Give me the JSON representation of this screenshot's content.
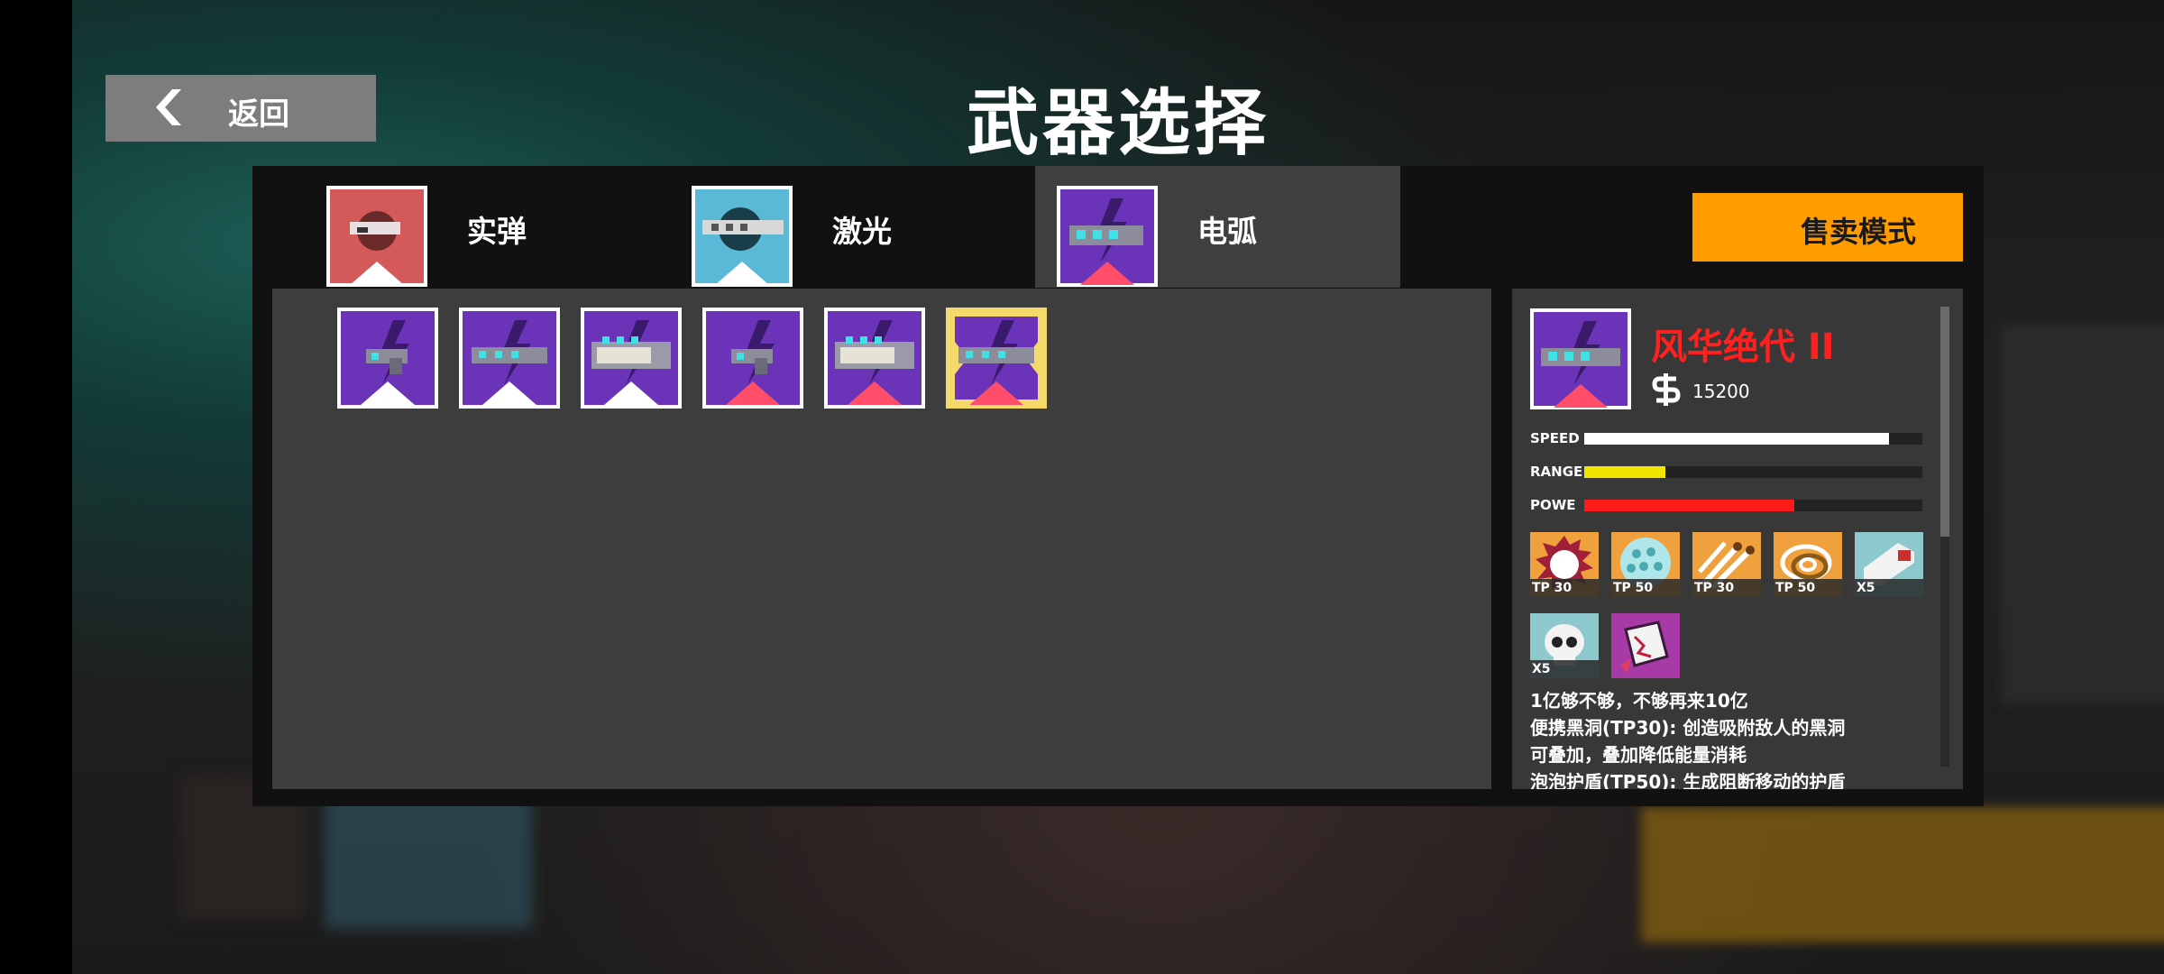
{
  "header": {
    "back_label": "返回",
    "title": "武器选择"
  },
  "tabs": [
    {
      "label": "实弹",
      "active": false
    },
    {
      "label": "激光",
      "active": false
    },
    {
      "label": "电弧",
      "active": true
    }
  ],
  "sell_button": {
    "label": "售卖模式"
  },
  "weapons": [
    {
      "icon": "arc-pistol-icon",
      "tier": "white",
      "selected": false
    },
    {
      "icon": "arc-rifle-icon",
      "tier": "white",
      "selected": false
    },
    {
      "icon": "arc-heavy-gun-icon",
      "tier": "white",
      "selected": false
    },
    {
      "icon": "arc-pistol-icon",
      "tier": "red",
      "selected": false
    },
    {
      "icon": "arc-heavy-gun-icon",
      "tier": "red",
      "selected": false
    },
    {
      "icon": "arc-rifle-icon",
      "tier": "red",
      "selected": true
    }
  ],
  "detail": {
    "name": "风华绝代 II",
    "price": "15200",
    "stats": [
      {
        "label": "SPEED",
        "value": 0.9,
        "color": "#ffffff"
      },
      {
        "label": "RANGE",
        "value": 0.24,
        "color": "#f2e600"
      },
      {
        "label": "POWE",
        "value": 0.62,
        "color": "#ff1a1a"
      }
    ],
    "skills": [
      {
        "icon": "black-hole-icon",
        "tag": "TP 30"
      },
      {
        "icon": "bubble-shield-icon",
        "tag": "TP 50"
      },
      {
        "icon": "missiles-icon",
        "tag": "TP 30"
      },
      {
        "icon": "vortex-icon",
        "tag": "TP 50"
      },
      {
        "icon": "turret-icon",
        "tag": "X5"
      },
      {
        "icon": "skull-icon",
        "tag": "X5"
      },
      {
        "icon": "broken-card-icon",
        "tag": ""
      }
    ],
    "description": [
      "1亿够不够，不够再来10亿",
      "便携黑洞(TP30): 创造吸附敌人的黑洞",
      "可叠加，叠加降低能量消耗",
      "泡泡护盾(TP50): 生成阻断移动的护盾"
    ]
  },
  "colors": {
    "accent": "#ff9c00",
    "weapon_bg": "#6b34b8",
    "selected_border": "#f5d96a"
  }
}
